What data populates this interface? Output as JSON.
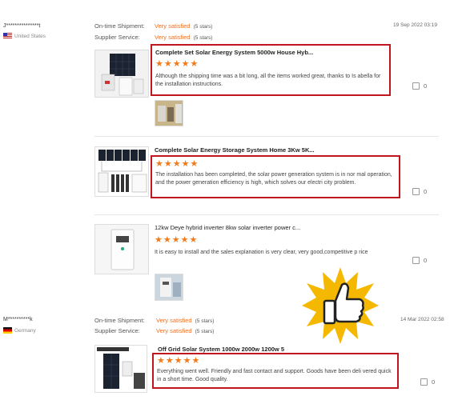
{
  "reviews": [
    {
      "reviewer": "J***************t",
      "country": "United States",
      "date": "19 Sep 2022 03:19",
      "ontime_label": "On-time Shipment:",
      "ontime_value": "Very satisfied",
      "ontime_stars": "(5 stars)",
      "service_label": "Supplier Service:",
      "service_value": "Very satisfied",
      "service_stars": "(5 stars)",
      "items": [
        {
          "title": "Complete Set Solar Energy System 5000w House Hyb...",
          "stars": "★★★★★",
          "text": "Although the shipping time was a bit long, all the items worked great, thanks to Is abella for the installation instructions.",
          "likes": "0"
        },
        {
          "title": "Complete Solar Energy Storage System Home 3Kw 5K...",
          "stars": "★★★★★",
          "text": "The installation has been completed, the solar power generation system is in nor mal operation, and the power generation efficiency is high, which solves our electri city problem.",
          "likes": "0"
        },
        {
          "title": "12kw Deye hybrid inverter 8kw solar inverter power c...",
          "stars": "★★★★★",
          "text": "It is easy to install and the sales explanation is very clear, very good,competitive p rice",
          "likes": "0"
        }
      ]
    },
    {
      "reviewer": "M**********k",
      "country": "Germany",
      "date": "14 Mar 2022 02:58",
      "ontime_label": "On-time Shipment:",
      "ontime_value": "Very satisfied",
      "ontime_stars": "(5 stars)",
      "service_label": "Supplier Service:",
      "service_value": "Very satisfied",
      "service_stars": "(5 stars)",
      "items": [
        {
          "title": "Off Grid Solar System 1000w 2000w 1200w 5",
          "stars": "★★★★★",
          "text": "Everything went well. Friendly and fast contact and support. Goods have been deli vered quick in a short time. Good quality.",
          "likes": "0"
        }
      ]
    }
  ],
  "icons": {
    "like": "thumbs-up-icon",
    "sticker": "thumbs-up-sticker"
  },
  "colors": {
    "accent": "#e8722a",
    "star": "#f27a1a",
    "highlight": "#c0161e",
    "sticker": "#f5b800"
  }
}
